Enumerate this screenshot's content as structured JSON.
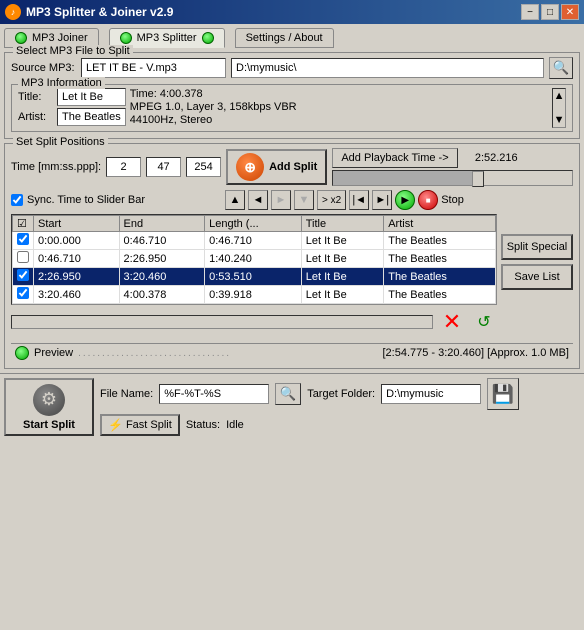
{
  "window": {
    "title": "MP3 Splitter & Joiner v2.9",
    "min_label": "−",
    "max_label": "□",
    "close_label": "✕"
  },
  "tabs": {
    "joiner": {
      "label": "MP3 Joiner"
    },
    "splitter": {
      "label": "MP3 Splitter",
      "active": true
    },
    "settings": {
      "label": "Settings / About"
    }
  },
  "select_mp3": {
    "section_label": "Select MP3 File to Split",
    "source_label": "Source MP3:",
    "filename": "LET IT BE - V.mp3",
    "path": "D:\\mymusic\\",
    "info_section_label": "MP3 Information",
    "title_label": "Title:",
    "title_value": "Let It Be",
    "artist_label": "Artist:",
    "artist_value": "The Beatles",
    "time_info": "Time: 4:00.378",
    "mpeg_info": "MPEG 1.0, Layer 3, 158kbps VBR",
    "hz_info": "44100Hz, Stereo"
  },
  "split_positions": {
    "section_label": "Set Split Positions",
    "time_label": "Time [mm:ss.ppp]:",
    "time_m": "2",
    "time_s": "47",
    "time_ms": "254",
    "add_split_label": "Add Split",
    "add_playback_label": "Add Playback Time ->",
    "time_display": "2:52.216",
    "sync_label": "Sync. Time to Slider Bar",
    "x2_label": "> x2",
    "stop_label": "Stop",
    "table": {
      "headers": [
        "☑",
        "Start",
        "End",
        "Length (...",
        "Title",
        "Artist"
      ],
      "rows": [
        {
          "checked": true,
          "start": "0:00.000",
          "end": "0:46.710",
          "length": "0:46.710",
          "title": "Let It Be",
          "artist": "The Beatles",
          "selected": false
        },
        {
          "checked": false,
          "start": "0:46.710",
          "end": "2:26.950",
          "length": "1:40.240",
          "title": "Let It Be",
          "artist": "The Beatles",
          "selected": false
        },
        {
          "checked": true,
          "start": "2:26.950",
          "end": "3:20.460",
          "length": "0:53.510",
          "title": "Let It Be",
          "artist": "The Beatles",
          "selected": true
        },
        {
          "checked": true,
          "start": "3:20.460",
          "end": "4:00.378",
          "length": "0:39.918",
          "title": "Let It Be",
          "artist": "The Beatles",
          "selected": false
        }
      ],
      "split_special_label": "Split Special",
      "save_list_label": "Save List"
    }
  },
  "preview": {
    "label": "Preview",
    "dots": "................................",
    "info": "[2:54.775 - 3:20.460] [Approx. 1.0 MB]"
  },
  "bottom": {
    "start_split_label": "Start Split",
    "file_name_label": "File Name:",
    "file_name_value": "%F-%T-%S",
    "target_folder_label": "Target Folder:",
    "target_folder_value": "D:\\mymusic",
    "fast_split_label": "Fast Split",
    "status_label": "Status:",
    "status_value": "Idle"
  }
}
